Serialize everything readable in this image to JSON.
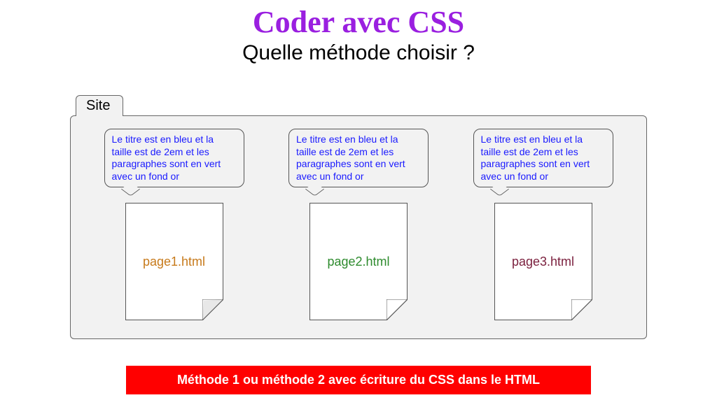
{
  "title": "Coder avec CSS",
  "subtitle": "Quelle méthode choisir ?",
  "tab_label": "Site",
  "bubble_text": "Le titre est en bleu et la taille est de 2em et les paragraphes sont en vert avec un fond or",
  "pages": [
    {
      "label": "page1.html",
      "colorClass": "c1"
    },
    {
      "label": "page2.html",
      "colorClass": "c2"
    },
    {
      "label": "page3.html",
      "colorClass": "c3"
    }
  ],
  "banner": "Méthode 1 ou méthode 2 avec écriture du CSS dans le HTML"
}
